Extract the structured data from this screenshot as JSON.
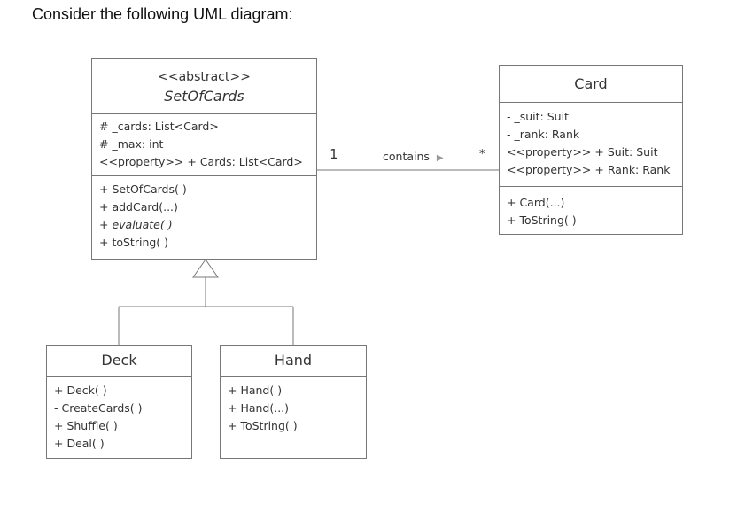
{
  "caption": "Consider the following UML diagram:",
  "classes": {
    "setofcards": {
      "stereotype": "<<abstract>>",
      "name": "SetOfCards",
      "attributes": [
        "# _cards: List<Card>",
        "# _max: int",
        "<<property>> + Cards: List<Card>"
      ],
      "methods": [
        "+ SetOfCards( )",
        "+ addCard(...)",
        "+ evaluate( )",
        "+ toString( )"
      ]
    },
    "card": {
      "name": "Card",
      "attributes": [
        "- _suit: Suit",
        "- _rank: Rank",
        "<<property>> + Suit: Suit",
        "<<property>> + Rank: Rank"
      ],
      "methods": [
        "+ Card(...)",
        "+ ToString( )"
      ]
    },
    "deck": {
      "name": "Deck",
      "methods": [
        "+ Deck( )",
        "- CreateCards( )",
        "+ Shuffle( )",
        "+ Deal( )"
      ]
    },
    "hand": {
      "name": "Hand",
      "methods": [
        "+ Hand( )",
        "+ Hand(...)",
        "+ ToString( )"
      ]
    }
  },
  "association": {
    "source_multiplicity": "1",
    "label": "contains",
    "direction_arrow": "▶",
    "target_multiplicity": "*"
  }
}
